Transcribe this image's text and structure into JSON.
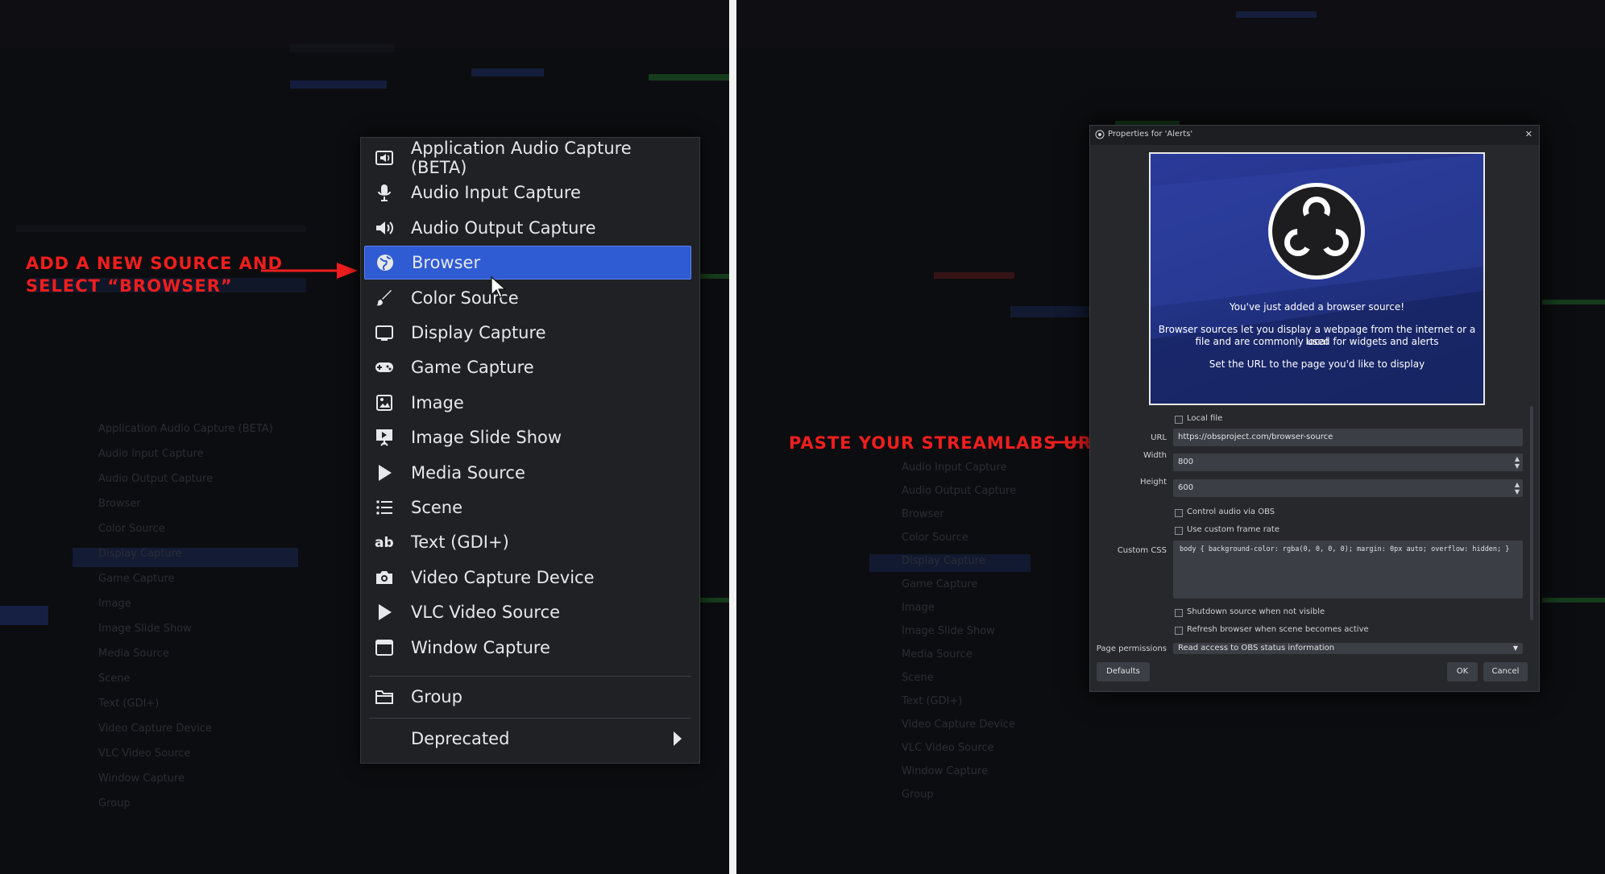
{
  "left_panel": {
    "annotation": {
      "line1": "ADD A NEW SOURCE AND",
      "line2": "SELECT “BROWSER”"
    },
    "menu": {
      "items": [
        {
          "label": "Application Audio Capture (BETA)",
          "icon": "app-audio-icon"
        },
        {
          "label": "Audio Input Capture",
          "icon": "microphone-icon"
        },
        {
          "label": "Audio Output Capture",
          "icon": "speaker-icon"
        },
        {
          "label": "Browser",
          "icon": "globe-icon",
          "highlighted": true
        },
        {
          "label": "Color Source",
          "icon": "brush-icon"
        },
        {
          "label": "Display Capture",
          "icon": "monitor-icon"
        },
        {
          "label": "Game Capture",
          "icon": "gamepad-icon"
        },
        {
          "label": "Image",
          "icon": "image-icon"
        },
        {
          "label": "Image Slide Show",
          "icon": "slideshow-icon"
        },
        {
          "label": "Media Source",
          "icon": "play-icon"
        },
        {
          "label": "Scene",
          "icon": "list-icon"
        },
        {
          "label": "Text (GDI+)",
          "icon": "text-icon"
        },
        {
          "label": "Video Capture Device",
          "icon": "camera-icon"
        },
        {
          "label": "VLC Video Source",
          "icon": "play-icon"
        },
        {
          "label": "Window Capture",
          "icon": "window-icon"
        }
      ],
      "group_label": "Group",
      "deprecated_label": "Deprecated"
    },
    "background_list": [
      "Application Audio Capture (BETA)",
      "Audio Input Capture",
      "Audio Output Capture",
      "Browser",
      "Color Source",
      "Display Capture",
      "Game Capture",
      "Image",
      "Image Slide Show",
      "Media Source",
      "Scene",
      "Text (GDI+)",
      "Video Capture Device",
      "VLC Video Source",
      "Window Capture",
      "Group"
    ]
  },
  "right_panel": {
    "annotation": "PASTE YOUR STREAMLABS URL",
    "dialog": {
      "title": "Properties for 'Alerts'",
      "close": "✕",
      "preview": {
        "headline": "You've just added a browser source!",
        "body_line1": "Browser sources let you display a webpage from the internet or a local",
        "body_line2": "file and are commonly used for widgets and alerts",
        "instruction": "Set the URL to the page you'd like to display"
      },
      "local_file_label": "Local file",
      "url_label": "URL",
      "url_value": "https://obsproject.com/browser-source",
      "width_label": "Width",
      "width_value": "800",
      "height_label": "Height",
      "height_value": "600",
      "control_audio_label": "Control audio via OBS",
      "custom_frame_rate_label": "Use custom frame rate",
      "custom_css_label": "Custom CSS",
      "custom_css_value": "body { background-color: rgba(0, 0, 0, 0); margin: 0px auto; overflow: hidden; }",
      "shutdown_label": "Shutdown source when not visible",
      "refresh_label": "Refresh browser when scene becomes active",
      "page_permissions_label": "Page permissions",
      "page_permissions_value": "Read access to OBS status information",
      "defaults_button": "Defaults",
      "ok_button": "OK",
      "cancel_button": "Cancel"
    },
    "background_list": [
      "Audio Input Capture",
      "Audio Output Capture",
      "Browser",
      "Color Source",
      "Display Capture",
      "Game Capture",
      "Image",
      "Image Slide Show",
      "Media Source",
      "Scene",
      "Text (GDI+)",
      "Video Capture Device",
      "VLC Video Source",
      "Window Capture",
      "Group"
    ]
  },
  "colors": {
    "accent_red": "#f01e1e",
    "menu_highlight": "#2f5bd3",
    "divider": "#f2f2f2"
  }
}
